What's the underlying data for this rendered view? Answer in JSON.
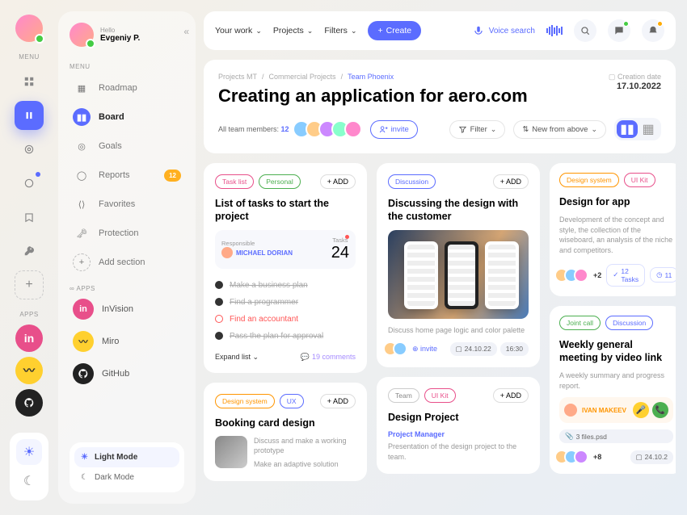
{
  "user": {
    "greeting": "Hello",
    "name": "Evgeniy P."
  },
  "menu": {
    "label": "MENU",
    "items": [
      "Roadmap",
      "Board",
      "Goals",
      "Reports",
      "Favorites",
      "Protection",
      "Add section"
    ],
    "reports_badge": "12"
  },
  "apps": {
    "label": "APPS",
    "items": [
      "InVision",
      "Miro",
      "GitHub"
    ]
  },
  "theme": {
    "light": "Light Mode",
    "dark": "Dark Mode"
  },
  "topbar": {
    "your_work": "Your work",
    "projects": "Projects",
    "filters": "Filters",
    "create": "Create",
    "voice": "Voice search"
  },
  "header": {
    "crumbs": [
      "Projects MT",
      "Commercial Projects",
      "Team Phoenix"
    ],
    "title": "Creating an application for aero.com",
    "members_label": "All team members:",
    "members_count": "12",
    "invite": "invite",
    "filter": "Filter",
    "new_from": "New from above",
    "date_label": "Creation date",
    "date": "17.10.2022"
  },
  "cards": {
    "tasklist": {
      "tag1": "Task list",
      "tag2": "Personal",
      "add": "ADD",
      "title": "List of tasks to start the project",
      "resp_label": "Responsible",
      "resp_name": "MICHAEL DORIAN",
      "tasks_label": "Tasks",
      "tasks_count": "24",
      "todos": [
        "Make a business plan",
        "Find a programmer",
        "Find an accountant",
        "Pass the plan for approval"
      ],
      "expand": "Expand list",
      "comments": "19 comments"
    },
    "booking": {
      "tag1": "Design system",
      "tag2": "UX",
      "add": "ADD",
      "title": "Booking card design",
      "line1": "Discuss and make a working prototype",
      "line2": "Make an adaptive solution"
    },
    "discuss": {
      "tag": "Discussion",
      "add": "ADD",
      "title": "Discussing the design with the customer",
      "desc": "Discuss home page logic and color palette",
      "invite": "invite",
      "date": "24.10.22",
      "time": "16:30"
    },
    "designproj": {
      "tag1": "Team",
      "tag2": "UI Kit",
      "add": "ADD",
      "title": "Design Project",
      "role": "Project Manager",
      "desc": "Presentation of the design project to the team."
    },
    "designapp": {
      "tag1": "Design system",
      "tag2": "UI Kit",
      "title": "Design for app",
      "desc": "Development of the concept and style, the collection of the wiseboard, an analysis of the niche and competitors.",
      "more": "+2",
      "tasks": "12 Tasks",
      "time": "11"
    },
    "meeting": {
      "tag1": "Joint call",
      "tag2": "Discussion",
      "title": "Weekly general meeting by video link",
      "desc": "A weekly summary and progress report.",
      "owner": "IVAN MAKEEV",
      "files": "3 files.psd",
      "more": "+8",
      "date": "24.10.2"
    }
  }
}
